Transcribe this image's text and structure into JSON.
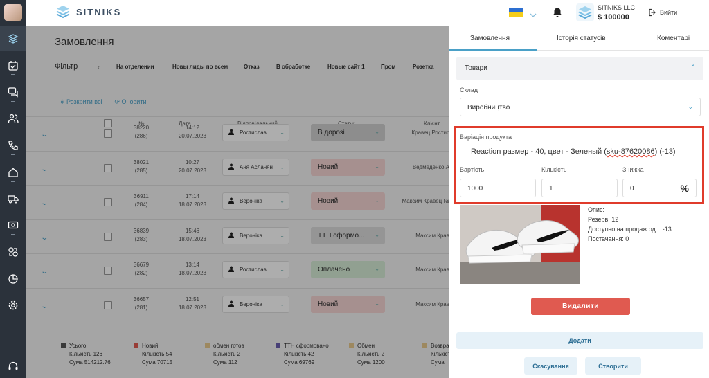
{
  "app": {
    "logo_text": "SITNIKS"
  },
  "header": {
    "company_name": "SITNIKS LLC",
    "balance": "$ 100000",
    "logout_label": "Вийти",
    "colors": {
      "flag_blue": "#2d6fd1",
      "flag_yellow": "#f4cd1a"
    }
  },
  "sidebar": {
    "items": [
      {
        "icon": "layers-icon"
      },
      {
        "icon": "calendar-check-icon"
      },
      {
        "icon": "chat-icon"
      },
      {
        "icon": "users-icon"
      },
      {
        "icon": "phone-icon"
      },
      {
        "icon": "home-icon"
      },
      {
        "icon": "truck-icon"
      },
      {
        "icon": "cash-icon"
      },
      {
        "icon": "integrations-icon"
      },
      {
        "icon": "pie-chart-icon"
      },
      {
        "icon": "settings-icon"
      },
      {
        "icon": "support-headset-icon"
      }
    ]
  },
  "orders": {
    "title": "Замовлення",
    "filter_label": "Фільтр",
    "filter_tabs": [
      "На отделении",
      "Новы лиды по всем",
      "Отказ",
      "В обработке",
      "Новые сайт 1",
      "Пром",
      "Розетка"
    ],
    "expand_all": "Розкрити всі",
    "refresh": "Оновити",
    "columns": {
      "number": "№",
      "date": "Дата",
      "responsible": "Відповідальний",
      "status": "Статус",
      "client": "Клієнт"
    },
    "rows": [
      {
        "id": "38220",
        "sub": "(286)",
        "time": "14:12",
        "date": "20.07.2023",
        "responsible": "Ростислав",
        "status": "В дорозі",
        "client": "Кравец Ростис"
      },
      {
        "id": "38021",
        "sub": "(285)",
        "time": "10:27",
        "date": "20.07.2023",
        "responsible": "Аня Асланян",
        "status": "Новий",
        "client": "Ведмеденко А"
      },
      {
        "id": "36911",
        "sub": "(284)",
        "time": "17:14",
        "date": "18.07.2023",
        "responsible": "Вероніка",
        "status": "Новий",
        "client": "Максим Кравец №"
      },
      {
        "id": "36839",
        "sub": "(283)",
        "time": "15:46",
        "date": "18.07.2023",
        "responsible": "Вероніка",
        "status": "ТТН сформо...",
        "client": "Максим Крав"
      },
      {
        "id": "36679",
        "sub": "(282)",
        "time": "13:14",
        "date": "18.07.2023",
        "responsible": "Ростислав",
        "status": "Оплачено",
        "client": "Максим Крав"
      },
      {
        "id": "36657",
        "sub": "(281)",
        "time": "12:51",
        "date": "18.07.2023",
        "responsible": "Вероніка",
        "status": "Новий",
        "client": "Максим Крав"
      }
    ],
    "status_colors": {
      "В дорозі": "#d0d0d0",
      "Новий": "#f5d5d3",
      "ТТН сформо...": "#dcdcdc",
      "Оплачено": "#d6ecd6"
    },
    "legend": [
      {
        "name": "Усього",
        "count": "Кількість 126",
        "sum": "Сума 514212.76",
        "color": "#555555"
      },
      {
        "name": "Новий",
        "count": "Кількість 54",
        "sum": "Сума 70715",
        "color": "#e05a50"
      },
      {
        "name": "обмен готов",
        "count": "Кількість 2",
        "sum": "Сума 112",
        "color": "#e8c98c"
      },
      {
        "name": "ТТН сформовано",
        "count": "Кількість 42",
        "sum": "Сума 69769",
        "color": "#6a5fb0"
      },
      {
        "name": "Обмен",
        "count": "Кількість 2",
        "sum": "Сума 1200",
        "color": "#e8c98c"
      },
      {
        "name": "Возвра",
        "count": "Кількість",
        "sum": "Сума",
        "color": "#e8c98c"
      }
    ]
  },
  "panel": {
    "tabs": [
      "Замовлення",
      "Історія статусів",
      "Коментарі"
    ],
    "goods_title": "Товари",
    "warehouse_label": "Склад",
    "warehouse_value": "Виробництво",
    "variation_label": "Варіація продукта",
    "variation_text": "Reaction размер - 40, цвет - Зеленый (",
    "variation_sku": "sku-87620086",
    "variation_suffix": ")  (-13)",
    "price_label": "Вартість",
    "price_value": "1000",
    "qty_label": "Кількість",
    "qty_value": "1",
    "discount_label": "Знижка",
    "discount_value": "0",
    "discount_unit": "%",
    "info": {
      "description": "Опис:",
      "reserve": "Резерв: 12",
      "available": "Доступно на продаж од. : -13",
      "supply": "Постачання: 0"
    },
    "delete_label": "Видалити",
    "add_label": "Додати",
    "cancel_label": "Скасування",
    "create_label": "Створити",
    "colors": {
      "accent": "#4aa0c7",
      "highlight": "#e03b2b",
      "danger": "#e05a50"
    }
  }
}
